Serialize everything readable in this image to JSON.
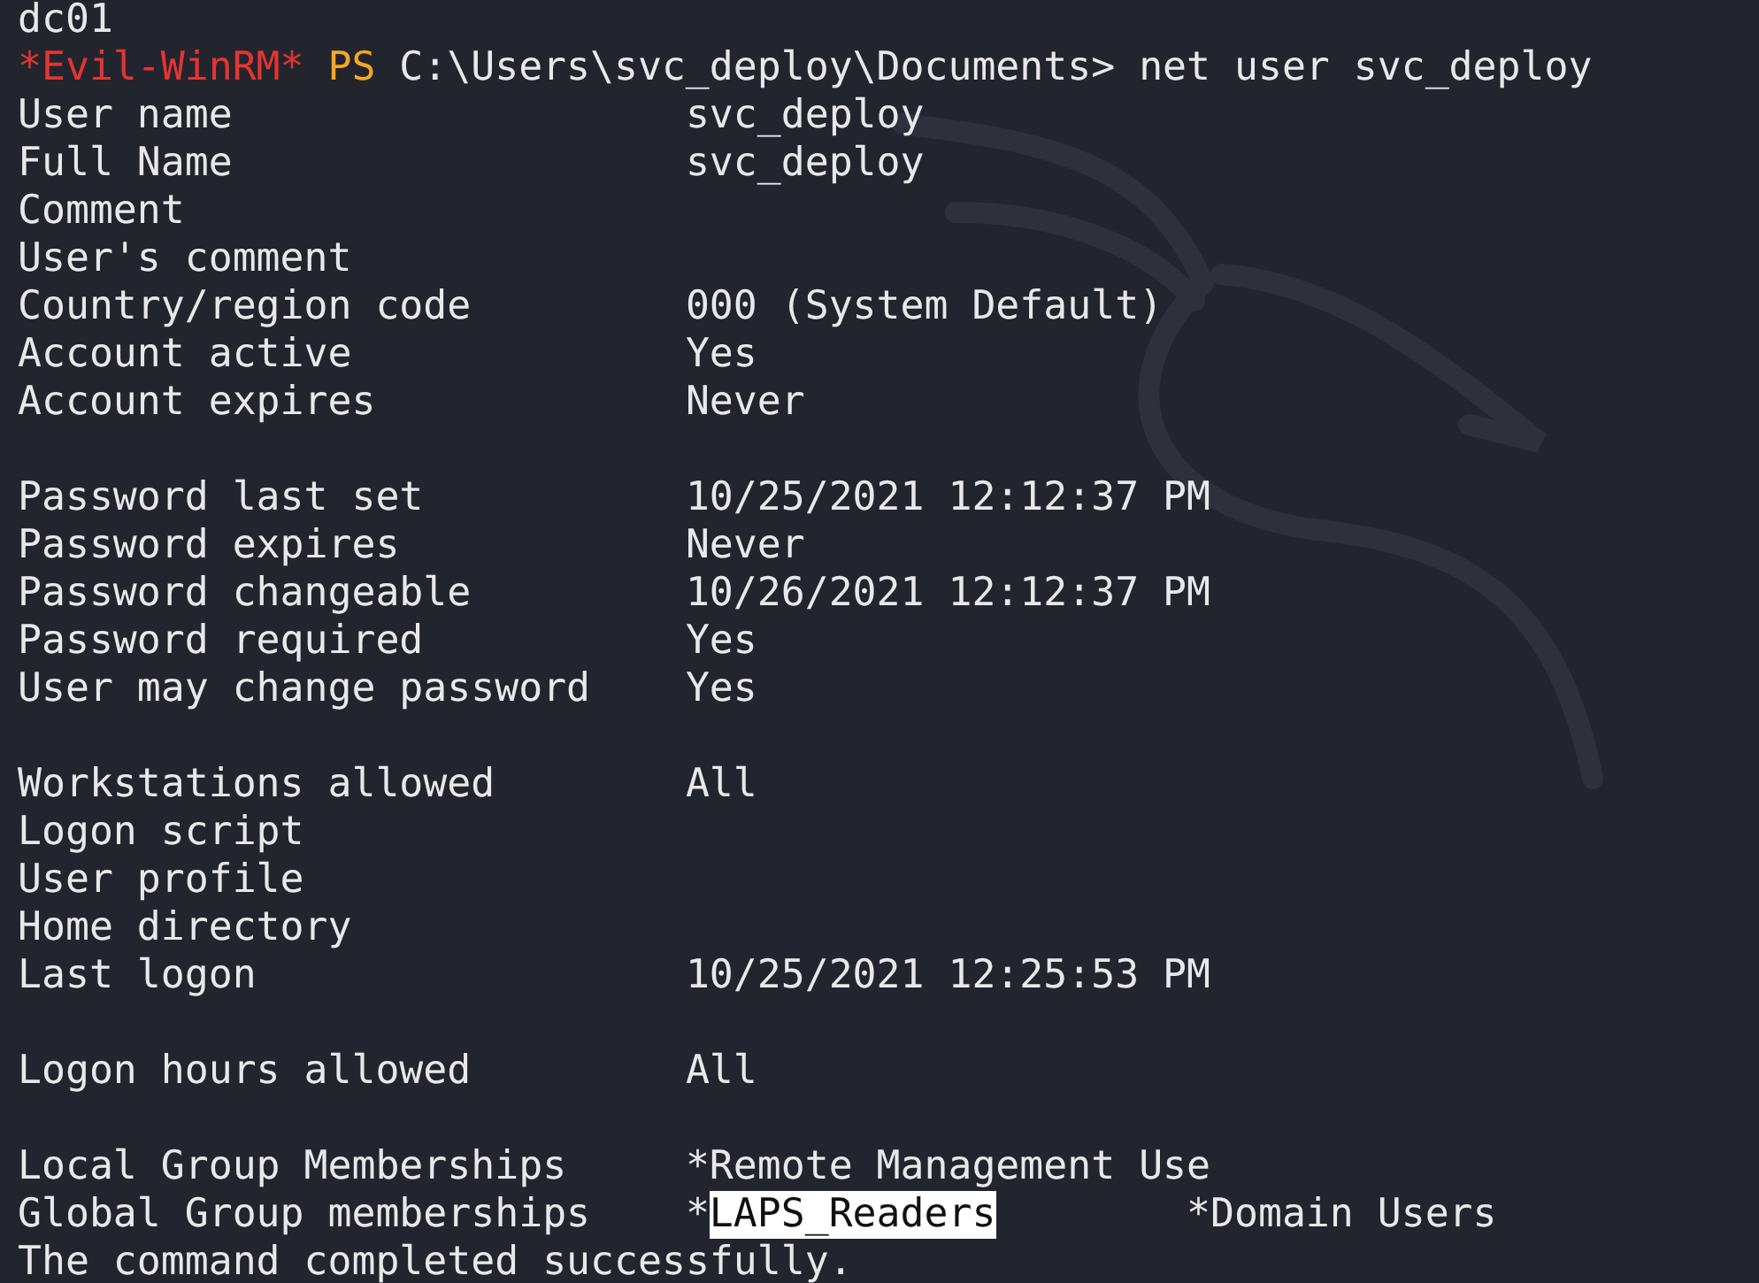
{
  "lines": [
    {
      "kind": "text",
      "text": "dc01"
    },
    {
      "kind": "prompt",
      "shell": "*Evil-WinRM*",
      "ps": "PS",
      "path": "C:\\Users\\svc_deploy\\Documents>",
      "command": "net user svc_deploy"
    },
    {
      "kind": "field",
      "label": "User name",
      "value": "svc_deploy"
    },
    {
      "kind": "field",
      "label": "Full Name",
      "value": "svc_deploy"
    },
    {
      "kind": "field",
      "label": "Comment"
    },
    {
      "kind": "field",
      "label": "User's comment"
    },
    {
      "kind": "field",
      "label": "Country/region code",
      "value": "000 (System Default)"
    },
    {
      "kind": "field",
      "label": "Account active",
      "value": "Yes"
    },
    {
      "kind": "field",
      "label": "Account expires",
      "value": "Never"
    },
    {
      "kind": "blank"
    },
    {
      "kind": "field",
      "label": "Password last set",
      "value": "10/25/2021 12:12:37 PM"
    },
    {
      "kind": "field",
      "label": "Password expires",
      "value": "Never"
    },
    {
      "kind": "field",
      "label": "Password changeable",
      "value": "10/26/2021 12:12:37 PM"
    },
    {
      "kind": "field",
      "label": "Password required",
      "value": "Yes"
    },
    {
      "kind": "field",
      "label": "User may change password",
      "value": "Yes"
    },
    {
      "kind": "blank"
    },
    {
      "kind": "field",
      "label": "Workstations allowed",
      "value": "All"
    },
    {
      "kind": "field",
      "label": "Logon script"
    },
    {
      "kind": "field",
      "label": "User profile"
    },
    {
      "kind": "field",
      "label": "Home directory"
    },
    {
      "kind": "field",
      "label": "Last logon",
      "value": "10/25/2021 12:25:53 PM"
    },
    {
      "kind": "blank"
    },
    {
      "kind": "field",
      "label": "Logon hours allowed",
      "value": "All"
    },
    {
      "kind": "blank"
    },
    {
      "kind": "groups",
      "label": "Local Group Memberships",
      "groups": [
        {
          "marker": "*",
          "name": "Remote Management Use",
          "highlighted": false
        }
      ]
    },
    {
      "kind": "groups",
      "label": "Global Group memberships",
      "groups": [
        {
          "marker": "*",
          "name": "LAPS_Readers",
          "highlighted": true
        },
        {
          "marker": "*",
          "name": "Domain Users",
          "highlighted": false
        }
      ]
    },
    {
      "kind": "text",
      "text": "The command completed successfully."
    }
  ]
}
